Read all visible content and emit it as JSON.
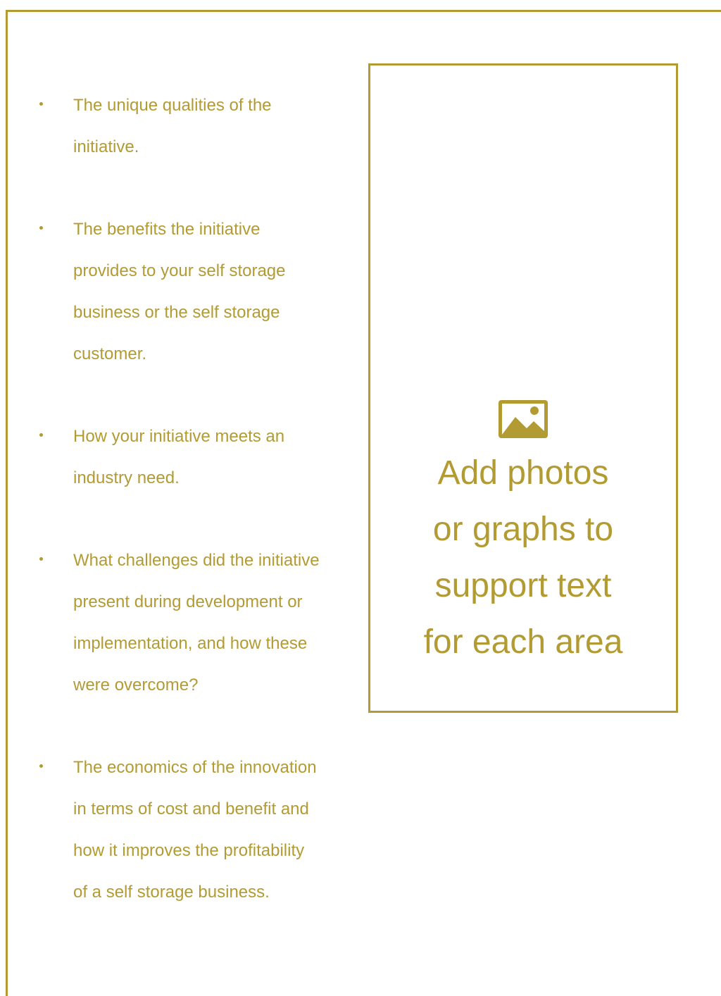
{
  "bullets": [
    {
      "lines": [
        "The unique qualities of the",
        "initiative."
      ]
    },
    {
      "lines": [
        "The benefits the initiative",
        "provides to your self storage",
        "business or the self storage",
        "customer."
      ]
    },
    {
      "lines": [
        "How your initiative meets an",
        "industry need."
      ]
    },
    {
      "lines": [
        "What challenges did the initiative",
        "present during development or",
        "implementation, and how these",
        "were overcome?"
      ]
    },
    {
      "lines": [
        "The economics of the innovation",
        "in terms of cost and benefit and",
        "how it improves the profitability",
        "of a self storage business."
      ]
    }
  ],
  "photo_placeholder": {
    "icon": "image-icon",
    "lines": [
      "Add photos",
      "or graphs to",
      "support text",
      "for each area"
    ]
  },
  "colors": {
    "accent": "#b39b33",
    "background": "#ffffff"
  }
}
